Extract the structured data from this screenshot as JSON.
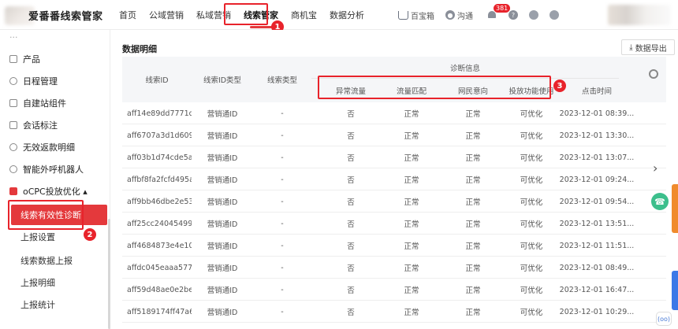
{
  "header": {
    "logo_text": "爱番番线索管家",
    "nav": [
      "首页",
      "公域营销",
      "私域营销",
      "线索管家",
      "商机宝",
      "数据分析"
    ],
    "active_nav": "线索管家",
    "right": {
      "baibaoxiang": "百宝箱",
      "goutong": "沟通",
      "notification_count": "381"
    },
    "step1": "1"
  },
  "sidebar": {
    "top_cut": "···",
    "items": [
      {
        "label": "产品",
        "icon": "box-icon"
      },
      {
        "label": "日程管理",
        "icon": "calendar-icon"
      },
      {
        "label": "自建站组件",
        "icon": "edit-icon"
      },
      {
        "label": "会话标注",
        "icon": "pen-icon"
      },
      {
        "label": "无效返款明细",
        "icon": "clock-icon"
      },
      {
        "label": "智能外呼机器人",
        "icon": "robot-icon"
      },
      {
        "label": "oCPC投放优化 ▴",
        "icon": "ocpc-icon"
      }
    ],
    "sub_items": [
      "线索有效性诊断",
      "上报设置",
      "线索数据上报",
      "上报明细",
      "上报统计"
    ],
    "active_sub": "线索有效性诊断",
    "step2": "2"
  },
  "main": {
    "section_title": "数据明细",
    "export_label": "数据导出",
    "export_icon": "download-icon",
    "columns": {
      "lead_id": "线索ID",
      "lead_id_type": "线索ID类型",
      "lead_type": "线索类型",
      "diag_group": "诊断信息",
      "abnormal_traffic": "异常流量",
      "traffic_match": "流量匹配",
      "netizen_intent": "网民意向",
      "delivery_usage": "投放功能使用",
      "click_time": "点击时间"
    },
    "step3": "3",
    "rows": [
      {
        "id": "aff14e89dd7771d...",
        "id_type": "营销通ID",
        "type": "-",
        "abn": "否",
        "match": "正常",
        "intent": "正常",
        "usage": "可优化",
        "time": "2023-12-01 08:39..."
      },
      {
        "id": "aff6707a3d1d609...",
        "id_type": "营销通ID",
        "type": "-",
        "abn": "否",
        "match": "正常",
        "intent": "正常",
        "usage": "可优化",
        "time": "2023-12-01 13:30..."
      },
      {
        "id": "aff03b1d74cde5a...",
        "id_type": "营销通ID",
        "type": "-",
        "abn": "否",
        "match": "正常",
        "intent": "正常",
        "usage": "可优化",
        "time": "2023-12-01 13:07..."
      },
      {
        "id": "affbf8fa2fcfd495a...",
        "id_type": "营销通ID",
        "type": "-",
        "abn": "否",
        "match": "正常",
        "intent": "正常",
        "usage": "可优化",
        "time": "2023-12-01 09:24..."
      },
      {
        "id": "aff9bb46dbe2e53...",
        "id_type": "营销通ID",
        "type": "-",
        "abn": "否",
        "match": "正常",
        "intent": "正常",
        "usage": "可优化",
        "time": "2023-12-01 09:54..."
      },
      {
        "id": "aff25cc24045499...",
        "id_type": "营销通ID",
        "type": "-",
        "abn": "否",
        "match": "正常",
        "intent": "正常",
        "usage": "可优化",
        "time": "2023-12-01 13:51..."
      },
      {
        "id": "aff4684873e4e10...",
        "id_type": "营销通ID",
        "type": "-",
        "abn": "否",
        "match": "正常",
        "intent": "正常",
        "usage": "可优化",
        "time": "2023-12-01 11:51..."
      },
      {
        "id": "affdc045eaaa577...",
        "id_type": "营销通ID",
        "type": "-",
        "abn": "否",
        "match": "正常",
        "intent": "正常",
        "usage": "可优化",
        "time": "2023-12-01 08:49..."
      },
      {
        "id": "aff59d48ae0e2be...",
        "id_type": "营销通ID",
        "type": "-",
        "abn": "否",
        "match": "正常",
        "intent": "正常",
        "usage": "可优化",
        "time": "2023-12-01 16:47..."
      },
      {
        "id": "aff5189174ff47a6...",
        "id_type": "营销通ID",
        "type": "-",
        "abn": "否",
        "match": "正常",
        "intent": "正常",
        "usage": "可优化",
        "time": "2023-12-01 10:29..."
      }
    ]
  },
  "floating": {
    "chevron": "›",
    "chat_label": "(oo)"
  },
  "colors": {
    "accent": "#e4393c",
    "annotation": "#e8232b",
    "header_bg": "#f5f6f8"
  }
}
